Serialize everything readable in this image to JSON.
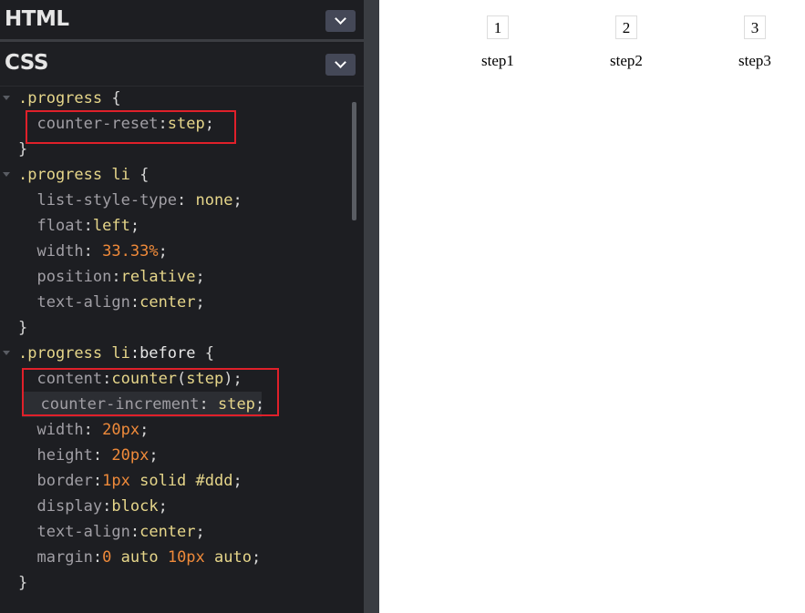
{
  "panels": {
    "html_title": "HTML",
    "css_title": "CSS"
  },
  "code_lines": [
    {
      "fold": true,
      "tokens": [
        {
          "c": "sel",
          "t": ".progress"
        },
        {
          "c": "punc",
          "t": " {"
        }
      ]
    },
    {
      "fold": false,
      "tokens": [
        {
          "c": "txt",
          "t": "  "
        },
        {
          "c": "prop",
          "t": "counter-reset"
        },
        {
          "c": "punc",
          "t": ":"
        },
        {
          "c": "val",
          "t": "step"
        },
        {
          "c": "punc",
          "t": ";"
        }
      ]
    },
    {
      "fold": false,
      "tokens": [
        {
          "c": "punc",
          "t": "}"
        }
      ]
    },
    {
      "fold": true,
      "tokens": [
        {
          "c": "sel",
          "t": ".progress li"
        },
        {
          "c": "punc",
          "t": " {"
        }
      ]
    },
    {
      "fold": false,
      "tokens": [
        {
          "c": "txt",
          "t": "  "
        },
        {
          "c": "prop",
          "t": "list-style-type"
        },
        {
          "c": "punc",
          "t": ": "
        },
        {
          "c": "val",
          "t": "none"
        },
        {
          "c": "punc",
          "t": ";"
        }
      ]
    },
    {
      "fold": false,
      "tokens": [
        {
          "c": "txt",
          "t": "  "
        },
        {
          "c": "prop",
          "t": "float"
        },
        {
          "c": "punc",
          "t": ":"
        },
        {
          "c": "val",
          "t": "left"
        },
        {
          "c": "punc",
          "t": ";"
        }
      ]
    },
    {
      "fold": false,
      "tokens": [
        {
          "c": "txt",
          "t": "  "
        },
        {
          "c": "prop",
          "t": "width"
        },
        {
          "c": "punc",
          "t": ": "
        },
        {
          "c": "num",
          "t": "33.33%"
        },
        {
          "c": "punc",
          "t": ";"
        }
      ]
    },
    {
      "fold": false,
      "tokens": [
        {
          "c": "txt",
          "t": "  "
        },
        {
          "c": "prop",
          "t": "position"
        },
        {
          "c": "punc",
          "t": ":"
        },
        {
          "c": "val",
          "t": "relative"
        },
        {
          "c": "punc",
          "t": ";"
        }
      ]
    },
    {
      "fold": false,
      "tokens": [
        {
          "c": "txt",
          "t": "  "
        },
        {
          "c": "prop",
          "t": "text-align"
        },
        {
          "c": "punc",
          "t": ":"
        },
        {
          "c": "val",
          "t": "center"
        },
        {
          "c": "punc",
          "t": ";"
        }
      ]
    },
    {
      "fold": false,
      "tokens": [
        {
          "c": "punc",
          "t": "}"
        }
      ]
    },
    {
      "fold": true,
      "tokens": [
        {
          "c": "sel",
          "t": ".progress li"
        },
        {
          "c": "txt",
          "t": ":before"
        },
        {
          "c": "punc",
          "t": " {"
        }
      ]
    },
    {
      "fold": false,
      "tokens": [
        {
          "c": "txt",
          "t": "  "
        },
        {
          "c": "prop",
          "t": "content"
        },
        {
          "c": "punc",
          "t": ":"
        },
        {
          "c": "val",
          "t": "counter"
        },
        {
          "c": "punc",
          "t": "("
        },
        {
          "c": "val",
          "t": "step"
        },
        {
          "c": "punc",
          "t": ");"
        }
      ]
    },
    {
      "fold": false,
      "hl": true,
      "tokens": [
        {
          "c": "txt",
          "t": "  "
        },
        {
          "c": "prop",
          "t": "counter-increment"
        },
        {
          "c": "punc",
          "t": ": "
        },
        {
          "c": "val",
          "t": "step"
        },
        {
          "c": "punc",
          "t": ";"
        }
      ]
    },
    {
      "fold": false,
      "tokens": [
        {
          "c": "txt",
          "t": "  "
        },
        {
          "c": "prop",
          "t": "width"
        },
        {
          "c": "punc",
          "t": ": "
        },
        {
          "c": "num",
          "t": "20px"
        },
        {
          "c": "punc",
          "t": ";"
        }
      ]
    },
    {
      "fold": false,
      "tokens": [
        {
          "c": "txt",
          "t": "  "
        },
        {
          "c": "prop",
          "t": "height"
        },
        {
          "c": "punc",
          "t": ": "
        },
        {
          "c": "num",
          "t": "20px"
        },
        {
          "c": "punc",
          "t": ";"
        }
      ]
    },
    {
      "fold": false,
      "tokens": [
        {
          "c": "txt",
          "t": "  "
        },
        {
          "c": "prop",
          "t": "border"
        },
        {
          "c": "punc",
          "t": ":"
        },
        {
          "c": "num",
          "t": "1px"
        },
        {
          "c": "val",
          "t": " solid #ddd"
        },
        {
          "c": "punc",
          "t": ";"
        }
      ]
    },
    {
      "fold": false,
      "tokens": [
        {
          "c": "txt",
          "t": "  "
        },
        {
          "c": "prop",
          "t": "display"
        },
        {
          "c": "punc",
          "t": ":"
        },
        {
          "c": "val",
          "t": "block"
        },
        {
          "c": "punc",
          "t": ";"
        }
      ]
    },
    {
      "fold": false,
      "tokens": [
        {
          "c": "txt",
          "t": "  "
        },
        {
          "c": "prop",
          "t": "text-align"
        },
        {
          "c": "punc",
          "t": ":"
        },
        {
          "c": "val",
          "t": "center"
        },
        {
          "c": "punc",
          "t": ";"
        }
      ]
    },
    {
      "fold": false,
      "tokens": [
        {
          "c": "txt",
          "t": "  "
        },
        {
          "c": "prop",
          "t": "margin"
        },
        {
          "c": "punc",
          "t": ":"
        },
        {
          "c": "num",
          "t": "0"
        },
        {
          "c": "val",
          "t": " auto "
        },
        {
          "c": "num",
          "t": "10px"
        },
        {
          "c": "val",
          "t": " auto"
        },
        {
          "c": "punc",
          "t": ";"
        }
      ]
    },
    {
      "fold": false,
      "tokens": [
        {
          "c": "punc",
          "t": "}"
        }
      ]
    }
  ],
  "preview": {
    "steps": [
      {
        "number": "1",
        "label": "step1"
      },
      {
        "number": "2",
        "label": "step2"
      },
      {
        "number": "3",
        "label": "step3"
      }
    ]
  },
  "colors": {
    "editor_bg": "#1d1e22",
    "selector": "#e6d68a",
    "property": "#a19fa5",
    "number": "#ef8a3a",
    "annotation_box": "#e0202a"
  }
}
